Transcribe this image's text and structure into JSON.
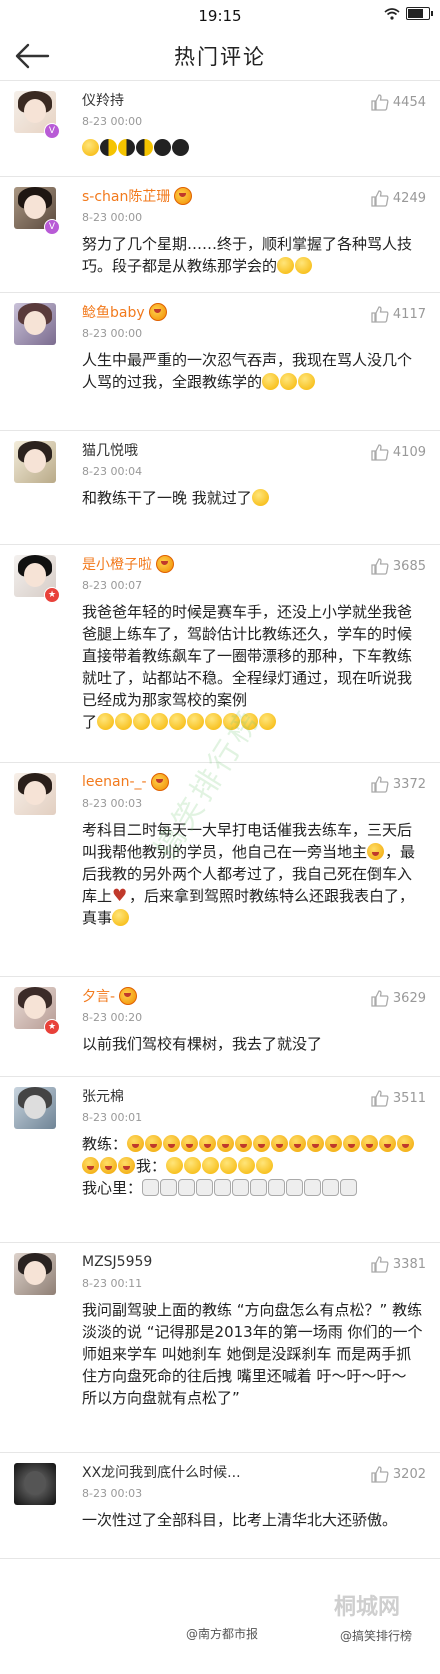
{
  "status": {
    "time": "19:15"
  },
  "header": {
    "title": "热门评论"
  },
  "comments": [
    {
      "name": "仪羚持",
      "time": "8-23 00:00",
      "likes": "4454",
      "text": ""
    },
    {
      "name": "s-chan陈芷珊",
      "time": "8-23 00:00",
      "likes": "4249",
      "text": "努力了几个星期……终于，顺利掌握了各种骂人技巧。段子都是从教练那学会的"
    },
    {
      "name": "鲶鱼baby",
      "time": "8-23 00:00",
      "likes": "4117",
      "text": "人生中最严重的一次忍气吞声，我现在骂人没几个人骂的过我，全跟教练学的"
    },
    {
      "name": "猫几悦哦",
      "time": "8-23 00:04",
      "likes": "4109",
      "text": "和教练干了一晚 我就过了"
    },
    {
      "name": "是小橙子啦",
      "time": "8-23 00:07",
      "likes": "3685",
      "text": "我爸爸年轻的时候是赛车手，还没上小学就坐我爸爸腿上练车了，驾龄估计比教练还久，学车的时候直接带着教练飙车了一圈带漂移的那种，下车教练就吐了，站都站不稳。全程绿灯通过，现在听说我已经成为那家驾校的案例",
      "text2": "了"
    },
    {
      "name": "leenan-_-",
      "time": "8-23 00:03",
      "likes": "3372",
      "text_a": "考科目二时每天一大早打电话催我去练车，三天后叫我帮他教别的学员，他自己在一旁当地主",
      "text_b": "，最后我教的另外两个人都考过了，我自己死在倒车入库上",
      "text_c": "，后来拿到驾照时教练特么还跟我表白了，真事"
    },
    {
      "name": "夕言-",
      "time": "8-23 00:20",
      "likes": "3629",
      "text": "以前我们驾校有棵树，我去了就没了"
    },
    {
      "name": "张元棉",
      "time": "8-23 00:01",
      "likes": "3511",
      "text_a": "教练：",
      "text_b": "我：",
      "text_c": "我心里："
    },
    {
      "name": "MZSJ5959",
      "time": "8-23 00:11",
      "likes": "3381",
      "text": "我问副驾驶上面的教练 “方向盘怎么有点松？” 教练淡淡的说 “记得那是2013年的第一场雨 你们的一个师姐来学车 叫她刹车 她倒是没踩刹车 而是两手抓住方向盘死命的往后拽 嘴里还喊着  吁～吁～吁～  所以方向盘就有点松了”"
    },
    {
      "name": "XX龙问我到底什么时候...",
      "time": "8-23 00:03",
      "likes": "3202",
      "text": "一次性过了全部科目，比考上清华北大还骄傲。"
    }
  ],
  "watermark": {
    "text": "搞笑排行榜"
  },
  "footer": {
    "credit_left": "@南方都市报",
    "credit_right": "@搞笑排行榜",
    "brand": "桐城网"
  },
  "icons": {
    "back": "back-arrow-icon",
    "like": "thumbs-up-icon",
    "verified": "verified-badge-icon",
    "medal": "medal-icon"
  },
  "colors": {
    "name_highlight": "#f27a1d",
    "meta": "#999999"
  }
}
